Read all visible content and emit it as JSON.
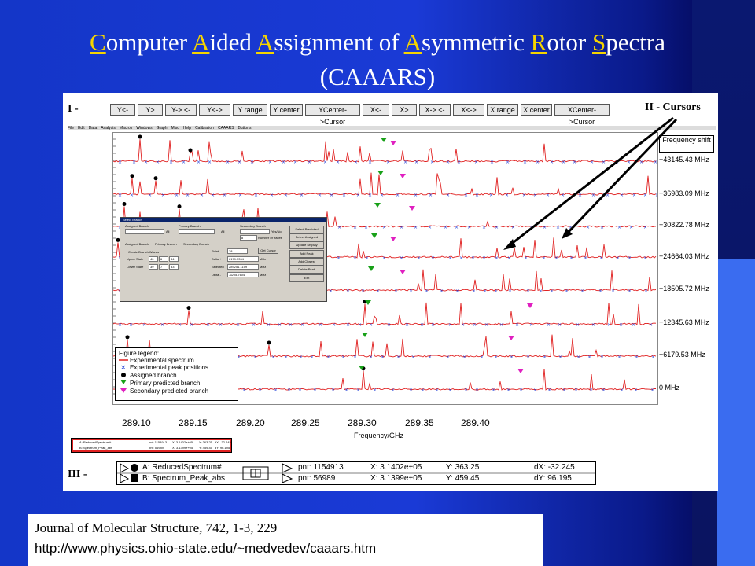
{
  "title": {
    "words": [
      {
        "cap": "C",
        "rest": "omputer "
      },
      {
        "cap": "A",
        "rest": "ided "
      },
      {
        "cap": "A",
        "rest": "ssignment "
      },
      {
        "plain": "of "
      },
      {
        "cap": "A",
        "rest": "symmetric "
      },
      {
        "cap": "R",
        "rest": "otor "
      },
      {
        "cap": "S",
        "rest": "pectra"
      }
    ],
    "line2": "(CAAARS)"
  },
  "section_labels": {
    "i": "I -",
    "ii": "II - Cursors",
    "iii": "III -"
  },
  "toolbar": [
    "Y<-",
    "Y>",
    "Y->.<-",
    "Y<->",
    "Y range",
    "Y center",
    "YCenter->Cursor",
    "X<-",
    "X>",
    "X->.<-",
    "X<->",
    "X range",
    "X center",
    "XCenter->Cursor"
  ],
  "menu": [
    "File",
    "Edit",
    "Data",
    "Analysis",
    "Macros",
    "Windows",
    "Graph",
    "Misc",
    "Help",
    "Calibration",
    "CAAARS",
    "Buttons"
  ],
  "shift_header": "Frequency shift",
  "shifts": [
    "+43145.43 MHz",
    "+36983.09 MHz",
    "+30822.78 MHz",
    "+24664.03 MHz",
    "+18505.72 MHz",
    "+12345.63 MHz",
    "+6179.53 MHz",
    "0 MHz"
  ],
  "x_ticks": [
    "289.10",
    "289.15",
    "289.20",
    "289.25",
    "289.30",
    "289.35",
    "289.40"
  ],
  "x_axis_label": "Frequency/GHz",
  "legend": {
    "title": "Figure legend:",
    "items": [
      "Experimental spectrum",
      "Experimental peak positions",
      "Assigned branch",
      "Primary predicted branch",
      "Secondary predicted branch"
    ]
  },
  "dialog": {
    "title": "Select Branch",
    "assigned_branch": "Assigned Branch",
    "primary_branch": "Primary Branch",
    "secondary_branch": "Secondary Branch",
    "tabs": [
      "Assigned Branch",
      "Primary Branch",
      "Secondary Branch"
    ],
    "create_branch": "Create Branch Waves",
    "upper_state": "Upper State",
    "lower_state": "Lower State",
    "upper_vals": [
      "40",
      "6",
      "34"
    ],
    "lower_vals": [
      "39",
      "7",
      "33"
    ],
    "point": "Point",
    "delta_plus": "Delta +",
    "selected": "Selected",
    "delta_minus": "Delta -",
    "point_val": "28",
    "delta_plus_val": "6179.5394",
    "selected_val": "289251.1159",
    "delta_minus_val": "-6205.7604",
    "unit": "MHz",
    "get_cursor": "Get Cursor",
    "number_of_traces": "Number of traces",
    "traces_val": "8",
    "yes_no": "Yes/No",
    "all": "All",
    "buttons": [
      "Select Predicted",
      "Select Assigned",
      "Update Display",
      "Add Peak",
      "Add Closest",
      "Delete Peak",
      "Exit"
    ]
  },
  "cursor_panel": {
    "a_name": "A: ReducedSpectrum#",
    "b_name": "B: Spectrum_Peak_abs",
    "a_pnt": "pnt: 1154913",
    "b_pnt": "pnt: 56989",
    "a_x": "X: 3.1402e+05",
    "b_x": "X: 3.1399e+05",
    "a_y": "Y: 363.25",
    "b_y": "Y: 459.45",
    "dx": "dX: -32.245",
    "dy": "dY: 96.195"
  },
  "citation": {
    "line1": "Journal of Molecular Structure, 742, 1-3, 229",
    "line2": "http://www.physics.ohio-state.edu/~medvedev/caaars.htm"
  },
  "colors": {
    "background": "#1a3ad6",
    "title_cap": "#f5d400",
    "spectrum": "#e02020",
    "peak_marker": "#1a3ad6",
    "assigned": "#000000",
    "primary": "#18a018",
    "secondary": "#e020c0",
    "highlight": "#e02020"
  }
}
